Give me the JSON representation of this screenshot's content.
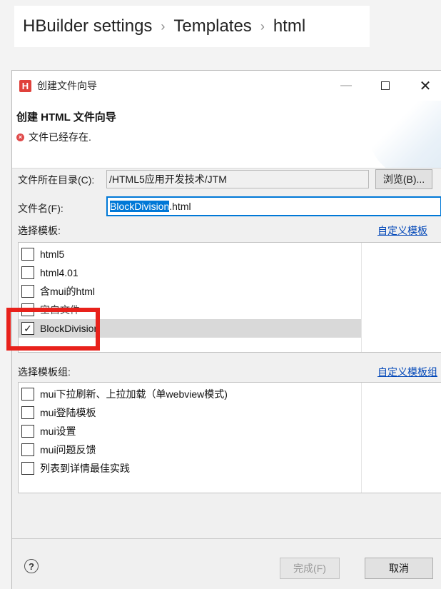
{
  "breadcrumb": {
    "items": [
      "HBuilder settings",
      "Templates",
      "html"
    ],
    "separator": "›"
  },
  "dialog": {
    "window_title": "创建文件向导",
    "app_icon_letter": "H",
    "min_glyph": "—",
    "close_glyph": "✕",
    "wizard_title": "创建 HTML 文件向导",
    "error_message": "文件已经存在.",
    "error_icon_glyph": "×",
    "directory": {
      "label": "文件所在目录(C):",
      "value": "/HTML5应用开发技术/JTM",
      "browse_label": "浏览(B)..."
    },
    "filename": {
      "label": "文件名(F):",
      "selected_part": "BlockDivision",
      "rest_part": ".html"
    },
    "template_section": {
      "label": "选择模板:",
      "custom_link": "自定义模板",
      "items": [
        {
          "label": "html5",
          "checked": false
        },
        {
          "label": "html4.01",
          "checked": false
        },
        {
          "label": "含mui的html",
          "checked": false
        },
        {
          "label": "空白文件",
          "checked": false
        },
        {
          "label": "BlockDivision",
          "checked": true
        }
      ]
    },
    "group_section": {
      "label": "选择模板组:",
      "custom_link": "自定义模板组",
      "items": [
        {
          "label": "mui下拉刷新、上拉加载（单webview模式)",
          "checked": false
        },
        {
          "label": "mui登陆模板",
          "checked": false
        },
        {
          "label": "mui设置",
          "checked": false
        },
        {
          "label": "mui问题反馈",
          "checked": false
        },
        {
          "label": "列表到详情最佳实践",
          "checked": false
        }
      ]
    },
    "help_glyph": "?",
    "finish_label": "完成(F)",
    "cancel_label": "取消",
    "check_glyph": "✓"
  },
  "colors": {
    "accent": "#0078d7",
    "highlight_box": "#e8211b",
    "link": "#0046b8",
    "app_icon": "#e0413b"
  }
}
